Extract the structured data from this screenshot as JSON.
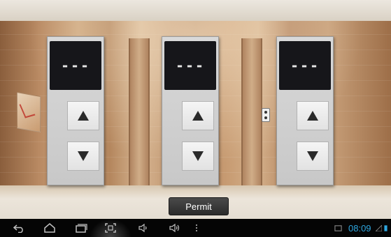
{
  "panels": [
    {
      "display": "---",
      "up_icon": "triangle-up-icon",
      "down_icon": "triangle-down-icon"
    },
    {
      "display": "---",
      "up_icon": "triangle-up-icon",
      "down_icon": "triangle-down-icon"
    },
    {
      "display": "---",
      "up_icon": "triangle-up-icon",
      "down_icon": "triangle-down-icon"
    }
  ],
  "permit_button": {
    "label": "Permit"
  },
  "navbar": {
    "icons": [
      "back-icon",
      "home-icon",
      "recent-apps-icon",
      "screenshot-icon",
      "volume-down-icon",
      "volume-up-icon",
      "menu-icon"
    ],
    "status": {
      "clock": "08:09",
      "accent": "#2ea6df"
    }
  }
}
